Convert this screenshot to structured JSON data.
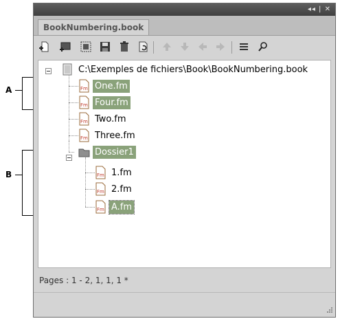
{
  "callouts": {
    "a_label": "A",
    "b_label": "B"
  },
  "panel": {
    "window_controls": "◂◂ | ✕",
    "tab_label": "BookNumbering.book",
    "toolbar": [
      "add-document-icon",
      "add-current-document-icon",
      "replace-document-icon",
      "save-book-icon",
      "delete-document-icon",
      "update-numbering-icon",
      "move-up-icon",
      "move-down-icon",
      "move-left-icon",
      "move-right-icon",
      "view-options-icon",
      "find-icon"
    ]
  },
  "tree": {
    "root_path": "C:\\Exemples de fichiers\\Book\\BookNumbering.book",
    "items": [
      {
        "label": "One.fm"
      },
      {
        "label": "Four.fm"
      },
      {
        "label": "Two.fm"
      },
      {
        "label": "Three.fm"
      }
    ],
    "folder": {
      "label": "Dossier1",
      "children": [
        {
          "label": "1.fm"
        },
        {
          "label": "2.fm"
        },
        {
          "label": "A.fm"
        }
      ]
    }
  },
  "status": {
    "pages": "Pages : 1 - 2, 1, 1, 1 *"
  },
  "colors": {
    "selection": "#8aa27a",
    "titlebar": "#4a4a4a",
    "panel_bg": "#d4d4d4"
  }
}
